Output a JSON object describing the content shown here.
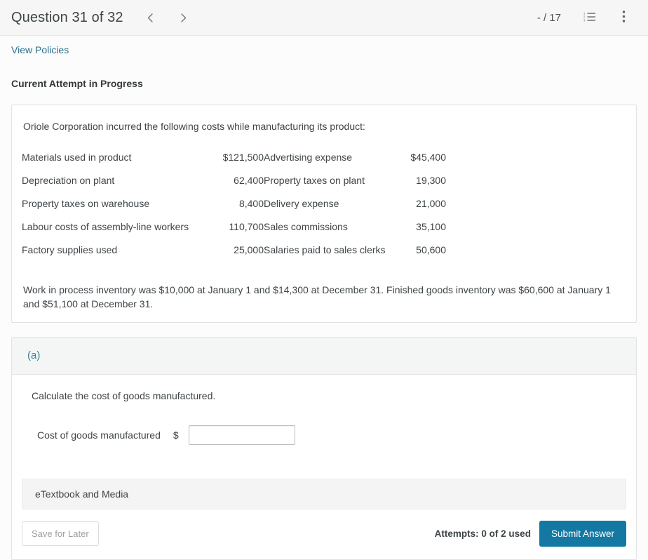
{
  "header": {
    "question_title": "Question 31 of 32",
    "prev_icon": "chevron-left-icon",
    "next_icon": "chevron-right-icon",
    "score": "- / 17",
    "list_icon": "ordered-list-icon",
    "menu_icon": "kebab-menu-icon"
  },
  "toolbar": {
    "view_policies": "View Policies",
    "current_attempt": "Current Attempt in Progress"
  },
  "problem": {
    "intro": "Oriole Corporation incurred the following costs while manufacturing its product:",
    "rows": [
      {
        "label_left": "Materials used in product",
        "amount_left": "$121,500",
        "label_right": "Advertising expense",
        "amount_right": "$45,400"
      },
      {
        "label_left": "Depreciation on plant",
        "amount_left": "62,400",
        "label_right": "Property taxes on plant",
        "amount_right": "19,300"
      },
      {
        "label_left": "Property taxes on warehouse",
        "amount_left": "8,400",
        "label_right": "Delivery expense",
        "amount_right": "21,000"
      },
      {
        "label_left": "Labour costs of assembly-line workers",
        "amount_left": "110,700",
        "label_right": "Sales commissions",
        "amount_right": "35,100"
      },
      {
        "label_left": "Factory supplies used",
        "amount_left": "25,000",
        "label_right": "Salaries paid to sales clerks",
        "amount_right": "50,600"
      }
    ],
    "inventory_note": "Work in process inventory was $10,000 at January 1 and $14,300 at December 31. Finished goods inventory was $60,600 at January 1 and $51,100 at December 31."
  },
  "part_a": {
    "label": "(a)",
    "prompt": "Calculate the cost of goods manufactured.",
    "answer_label": "Cost of goods manufactured",
    "currency_symbol": "$",
    "answer_value": "",
    "answer_placeholder": ""
  },
  "footer": {
    "etextbook": "eTextbook and Media",
    "save_for_later": "Save for Later",
    "attempts": "Attempts: 0 of 2 used",
    "submit": "Submit Answer"
  },
  "colors": {
    "accent": "#1379a2",
    "link": "#2d6f8e",
    "part_label": "#3a8296",
    "page_bg": "#f7f7f7"
  }
}
